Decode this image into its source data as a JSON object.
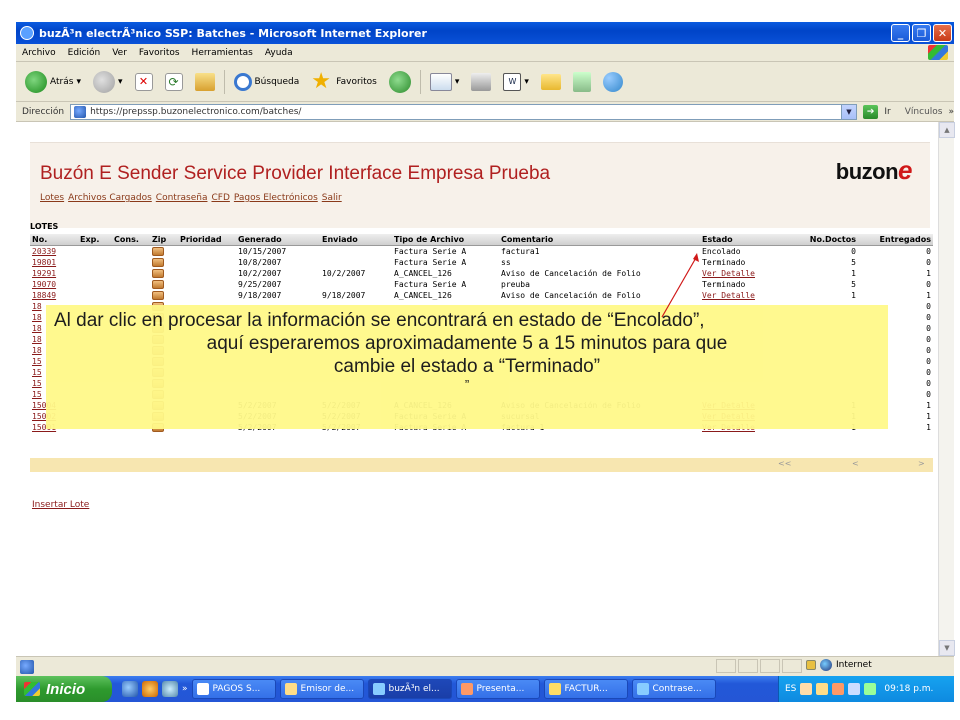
{
  "window": {
    "title": "buzÃ³n electrÃ³nico SSP: Batches - Microsoft Internet Explorer"
  },
  "menu": [
    "Archivo",
    "Edición",
    "Ver",
    "Favoritos",
    "Herramientas",
    "Ayuda"
  ],
  "toolbar": {
    "back_label": "Atrás",
    "search_label": "Búsqueda",
    "favorites_label": "Favoritos"
  },
  "address": {
    "label": "Dirección",
    "url": "https://prepssp.buzonelectronico.com/batches/",
    "go_label": "Ir",
    "links_label": "Vínculos"
  },
  "page": {
    "title": "Buzón E Sender Service Provider Interface Empresa Prueba",
    "logo_text": "buzon",
    "logo_e": "e",
    "nav": [
      "Lotes",
      "Archivos Cargados",
      "Contraseña",
      "CFD",
      "Pagos Electrónicos",
      "Salir"
    ],
    "section_title": "LOTES",
    "columns": [
      "No.",
      "Exp.",
      "Cons.",
      "Zip",
      "Prioridad",
      "Generado",
      "Enviado",
      "Tipo de Archivo",
      "Comentario",
      "Estado",
      "No.Doctos",
      "Entregados"
    ],
    "rows": [
      {
        "no": "20339",
        "generado": "10/15/2007",
        "enviado": "",
        "tipo": "Factura Serie A",
        "comentario": "factura1",
        "estado": "Encolado",
        "estado_link": false,
        "doctos": "0",
        "entregados": "0"
      },
      {
        "no": "19801",
        "generado": "10/8/2007",
        "enviado": "",
        "tipo": "Factura Serie A",
        "comentario": "ss",
        "estado": "Terminado",
        "estado_link": false,
        "doctos": "5",
        "entregados": "0"
      },
      {
        "no": "19291",
        "generado": "10/2/2007",
        "enviado": "10/2/2007",
        "tipo": "A_CANCEL_126",
        "comentario": "Aviso de Cancelación de Folio",
        "estado": "Ver Detalle",
        "estado_link": true,
        "doctos": "1",
        "entregados": "1"
      },
      {
        "no": "19070",
        "generado": "9/25/2007",
        "enviado": "",
        "tipo": "Factura Serie A",
        "comentario": "preuba",
        "estado": "Terminado",
        "estado_link": false,
        "doctos": "5",
        "entregados": "0"
      },
      {
        "no": "18849",
        "generado": "9/18/2007",
        "enviado": "9/18/2007",
        "tipo": "A_CANCEL_126",
        "comentario": "Aviso de Cancelación de Folio",
        "estado": "Ver Detalle",
        "estado_link": true,
        "doctos": "1",
        "entregados": "1"
      },
      {
        "no": "18",
        "generado": "",
        "enviado": "",
        "tipo": "",
        "comentario": "",
        "estado": "",
        "estado_link": false,
        "doctos": "",
        "entregados": "0"
      },
      {
        "no": "18",
        "generado": "",
        "enviado": "",
        "tipo": "",
        "comentario": "",
        "estado": "",
        "estado_link": false,
        "doctos": "",
        "entregados": "0"
      },
      {
        "no": "18",
        "generado": "",
        "enviado": "",
        "tipo": "",
        "comentario": "",
        "estado": "",
        "estado_link": false,
        "doctos": "",
        "entregados": "0"
      },
      {
        "no": "18",
        "generado": "",
        "enviado": "",
        "tipo": "",
        "comentario": "",
        "estado": "",
        "estado_link": false,
        "doctos": "",
        "entregados": "0"
      },
      {
        "no": "18",
        "generado": "",
        "enviado": "",
        "tipo": "",
        "comentario": "",
        "estado": "",
        "estado_link": false,
        "doctos": "",
        "entregados": "0"
      },
      {
        "no": "15",
        "generado": "",
        "enviado": "",
        "tipo": "",
        "comentario": "",
        "estado": "",
        "estado_link": false,
        "doctos": "",
        "entregados": "0"
      },
      {
        "no": "15",
        "generado": "",
        "enviado": "",
        "tipo": "",
        "comentario": "",
        "estado": "",
        "estado_link": false,
        "doctos": "",
        "entregados": "0"
      },
      {
        "no": "15",
        "generado": "",
        "enviado": "",
        "tipo": "",
        "comentario": "",
        "estado": "",
        "estado_link": false,
        "doctos": "",
        "entregados": "0"
      },
      {
        "no": "15",
        "generado": "",
        "enviado": "",
        "tipo": "",
        "comentario": "",
        "estado": "",
        "estado_link": false,
        "doctos": "",
        "entregados": "0"
      },
      {
        "no": "15004",
        "generado": "5/2/2007",
        "enviado": "5/2/2007",
        "tipo": "A_CANCEL_126",
        "comentario": "Aviso de Cancelación de Folio",
        "estado": "Ver Detalle",
        "estado_link": true,
        "doctos": "1",
        "entregados": "1"
      },
      {
        "no": "15002",
        "generado": "5/2/2007",
        "enviado": "5/2/2007",
        "tipo": "Factura Serie A",
        "comentario": "sucursal",
        "estado": "Ver Detalle",
        "estado_link": true,
        "doctos": "1",
        "entregados": "1"
      },
      {
        "no": "15001",
        "generado": "5/2/2007",
        "enviado": "5/2/2007",
        "tipo": "Factura Serie A",
        "comentario": "factura 1",
        "estado": "Ver Detalle",
        "estado_link": true,
        "doctos": "1",
        "entregados": "1"
      }
    ],
    "pager": {
      "first": "<<",
      "prev": "<",
      "next": ">"
    },
    "insert_link": "Insertar Lote"
  },
  "callout": {
    "line1": "Al dar clic en procesar la información se encontrará en estado de “Encolado”,",
    "line2": "aquí esperaremos aproximadamente  5  a 15 minutos para que",
    "line3": "cambie el estado a “Terminado”",
    "line4": "”"
  },
  "statusbar": {
    "zone": "Internet"
  },
  "taskbar": {
    "start": "Inicio",
    "tasks": [
      "PAGOS S...",
      "Emisor de...",
      "buzÃ³n el...",
      "Presenta...",
      "FACTUR...",
      "Contrase..."
    ],
    "lang": "ES",
    "clock": "09:18 p.m."
  }
}
